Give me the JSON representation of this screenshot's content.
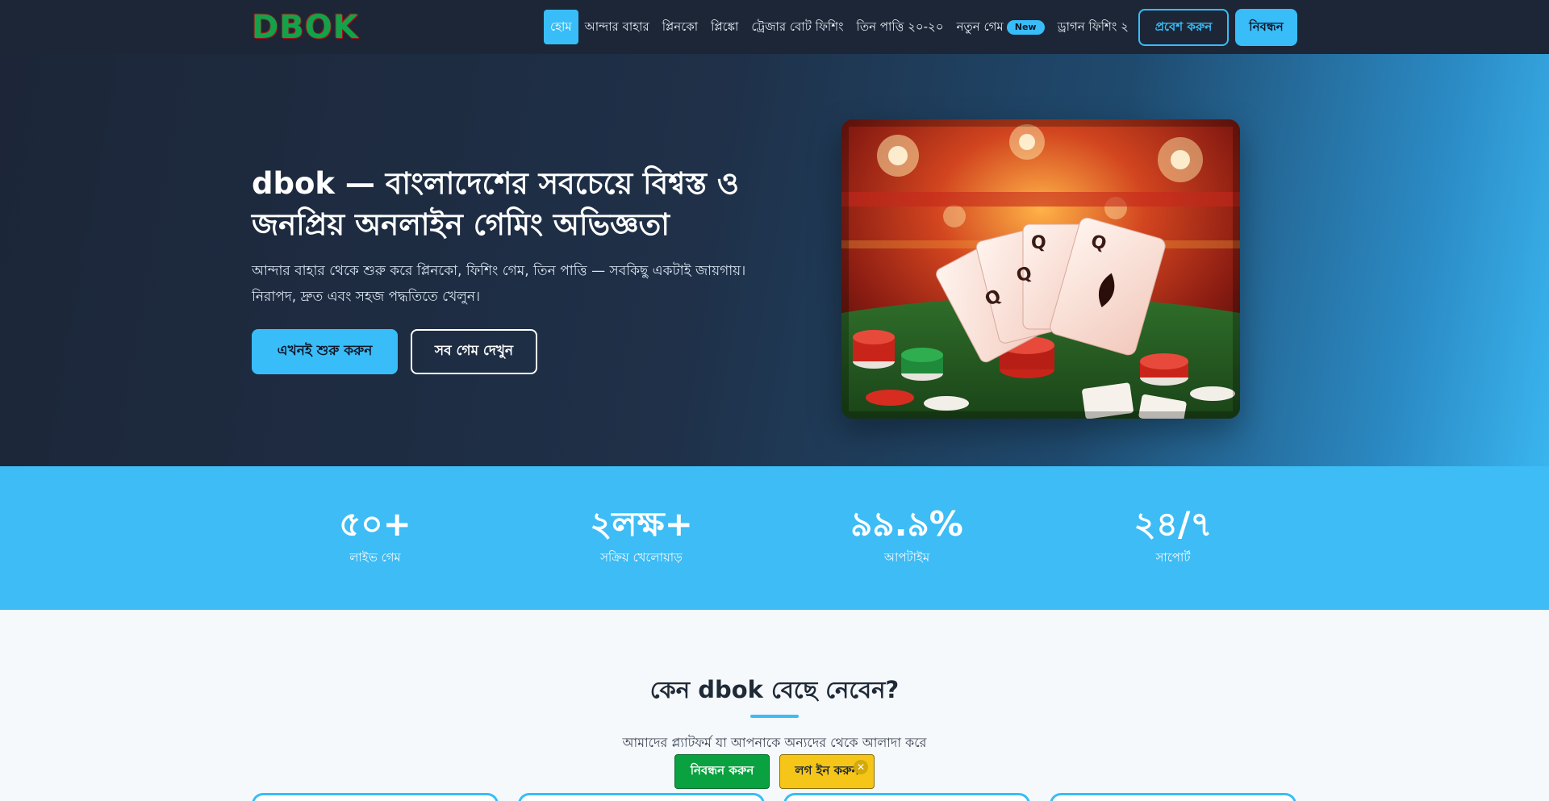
{
  "header": {
    "logo": "DBOK",
    "nav": [
      {
        "label": "হোম",
        "active": true
      },
      {
        "label": "আন্দার বাহার"
      },
      {
        "label": "প্লিনকো"
      },
      {
        "label": "প্লিঙ্কো"
      },
      {
        "label": "ট্রেজার বোট ফিশিং"
      },
      {
        "label": "তিন পাত্তি ২০-২০"
      },
      {
        "label": "নতুন গেম",
        "badge": "New"
      },
      {
        "label": "ড্রাগন ফিশিং ২"
      }
    ],
    "login_label": "প্রবেশ করুন",
    "register_label": "নিবন্ধন"
  },
  "hero": {
    "title": "dbok — বাংলাদেশের সবচেয়ে বিশ্বস্ত ও জনপ্রিয় অনলাইন গেমিং অভিজ্ঞতা",
    "subtitle": "আন্দার বাহার থেকে শুরু করে প্লিনকো, ফিশিং গেম, তিন পাত্তি — সবকিছু একটাই জায়গায়। নিরাপদ, দ্রুত এবং সহজ পদ্ধতিতে খেলুন।",
    "primary_button": "এখনই শুরু করুন",
    "secondary_button": "সব গেম দেখুন"
  },
  "stats": [
    {
      "value": "৫০+",
      "label": "লাইভ গেম"
    },
    {
      "value": "২লক্ষ+",
      "label": "সক্রিয় খেলোয়াড়"
    },
    {
      "value": "৯৯.৯%",
      "label": "আপটাইম"
    },
    {
      "value": "২৪/৭",
      "label": "সাপোর্ট"
    }
  ],
  "why": {
    "title": "কেন dbok বেছে নেবেন?",
    "subtitle": "আমাদের প্ল্যাটফর্ম যা আপনাকে অন্যদের থেকে আলাদা করে"
  },
  "floating": {
    "register_label": "নিবন্ধন করুন",
    "login_label": "লগ ইন করুন",
    "close_glyph": "✕"
  },
  "colors": {
    "accent": "#38bdf8",
    "navbar": "#1c2636",
    "stats_bg": "#3dbcf5",
    "float_register": "#0aa140",
    "float_login": "#f5c518"
  }
}
